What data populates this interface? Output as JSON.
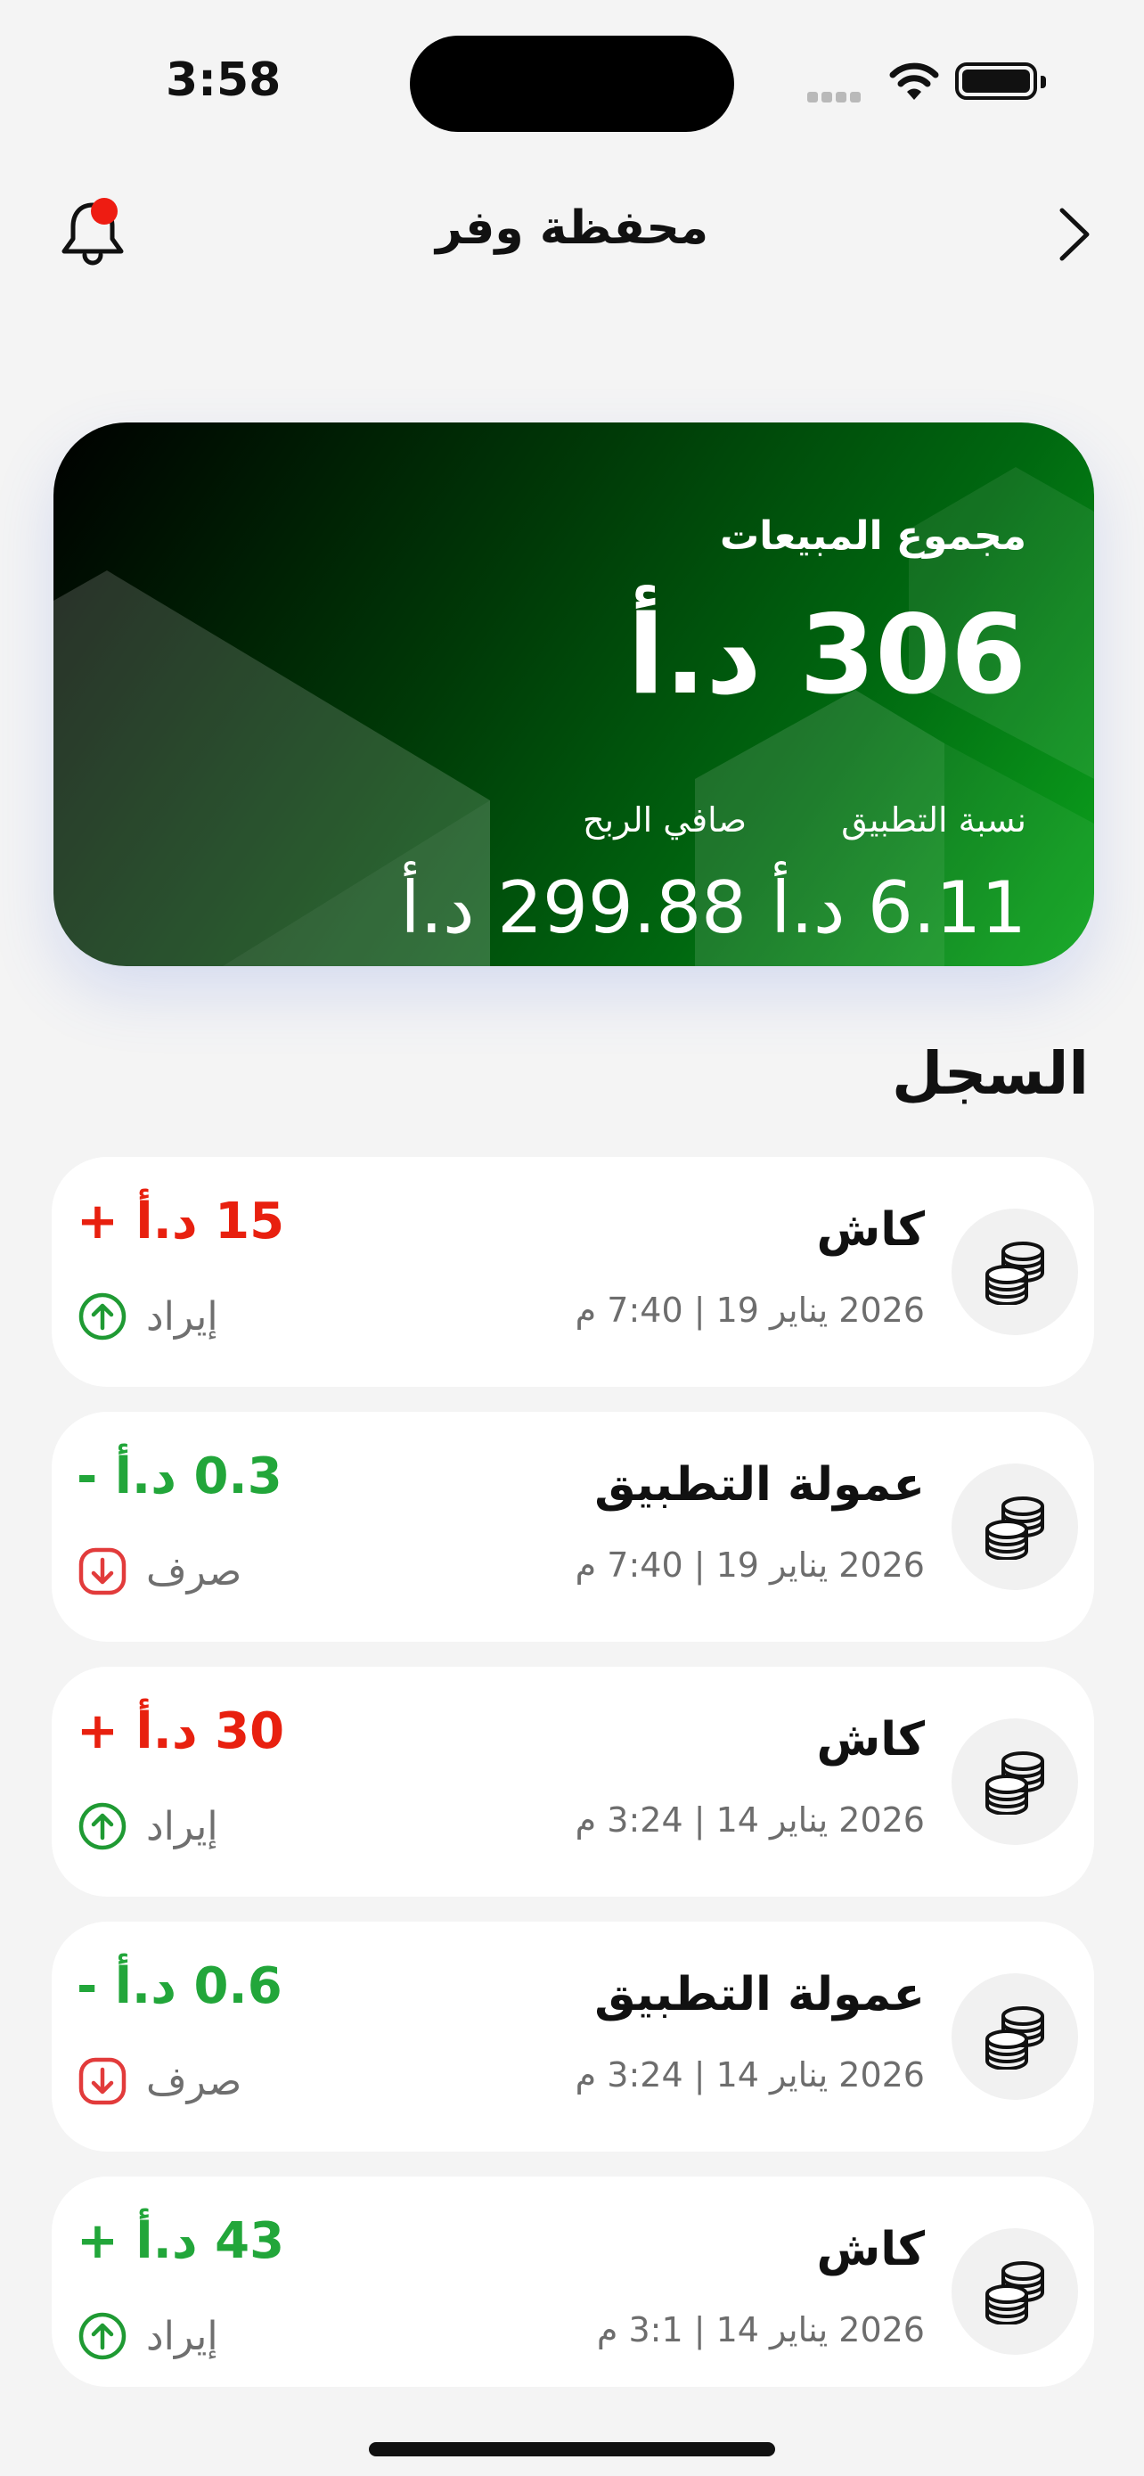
{
  "status_bar": {
    "time": "3:58"
  },
  "header": {
    "title": "محفظة وفر"
  },
  "summary_card": {
    "label": "مجموع المبيعات",
    "total": "306 د.أ",
    "app_share_label": "نسبة التطبيق",
    "app_share_value": "6.11 د.أ",
    "net_profit_label": "صافي الربح",
    "net_profit_value": "299.88 د.أ"
  },
  "history": {
    "title": "السجل",
    "items": [
      {
        "title": "كاش",
        "date": "2026 يناير 19 | 7:40 م",
        "amount": "15 د.أ +",
        "type": "إيراد",
        "direction": "up",
        "amount_color": "#e8200f"
      },
      {
        "title": "عمولة التطبيق",
        "date": "2026 يناير 19 | 7:40 م",
        "amount": "0.3 د.أ -",
        "type": "صرف",
        "direction": "down",
        "amount_color": "#22a63a"
      },
      {
        "title": "كاش",
        "date": "2026 يناير 14 | 3:24 م",
        "amount": "30 د.أ +",
        "type": "إيراد",
        "direction": "up",
        "amount_color": "#e8200f"
      },
      {
        "title": "عمولة التطبيق",
        "date": "2026 يناير 14 | 3:24 م",
        "amount": "0.6 د.أ -",
        "type": "صرف",
        "direction": "down",
        "amount_color": "#22a63a"
      },
      {
        "title": "كاش",
        "date": "2026 يناير 14 | 3:1 م",
        "amount": "43 د.أ +",
        "type": "إيراد",
        "direction": "up",
        "amount_color": "#22a63a"
      }
    ]
  },
  "colors": {
    "up_icon": "#1f9a33",
    "down_icon": "#e23b3b",
    "notification_dot": "#ee1c12"
  },
  "icons": {
    "notification": "bell-icon",
    "back": "chevron-right-icon",
    "coins": "coins-icon",
    "income": "arrow-up-circle-icon",
    "expense": "arrow-down-circle-icon"
  }
}
